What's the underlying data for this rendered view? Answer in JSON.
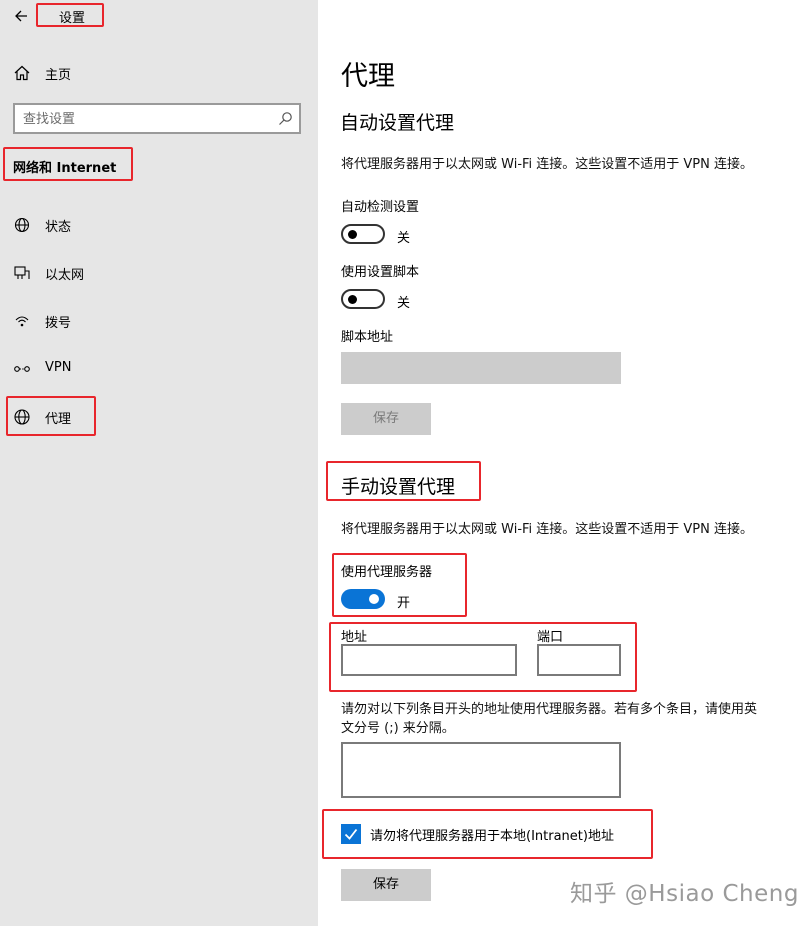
{
  "sidebar": {
    "app_title": "设置",
    "home_label": "主页",
    "search": {
      "placeholder": "查找设置"
    },
    "section_label": "网络和 Internet",
    "items": [
      {
        "label": "状态",
        "icon": "status-globe-icon"
      },
      {
        "label": "以太网",
        "icon": "ethernet-icon"
      },
      {
        "label": "拨号",
        "icon": "dialup-icon"
      },
      {
        "label": "VPN",
        "icon": "vpn-icon"
      },
      {
        "label": "代理",
        "icon": "proxy-globe-icon"
      }
    ]
  },
  "main": {
    "page_title": "代理",
    "auto": {
      "heading": "自动设置代理",
      "description": "将代理服务器用于以太网或 Wi-Fi 连接。这些设置不适用于 VPN 连接。",
      "detect_label": "自动检测设置",
      "detect_state": "关",
      "script_label": "使用设置脚本",
      "script_state": "关",
      "script_address_label": "脚本地址",
      "script_address_value": "",
      "save_label": "保存"
    },
    "manual": {
      "heading": "手动设置代理",
      "description": "将代理服务器用于以太网或 Wi-Fi 连接。这些设置不适用于 VPN 连接。",
      "use_proxy_label": "使用代理服务器",
      "use_proxy_state": "开",
      "address_label": "地址",
      "address_value": "",
      "port_label": "端口",
      "port_value": "",
      "exceptions_desc_line1": "请勿对以下列条目开头的地址使用代理服务器。若有多个条目，请使用英",
      "exceptions_desc_line2": "文分号 (;) 来分隔。",
      "exceptions_value": "",
      "local_checkbox_label": "请勿将代理服务器用于本地(Intranet)地址",
      "local_checked": true,
      "save_label": "保存"
    }
  },
  "watermark": "知乎 @Hsiao Cheng",
  "colors": {
    "accent": "#0a74d6",
    "highlight_box": "#e8262c",
    "sidebar_bg": "#e6e6e6"
  }
}
